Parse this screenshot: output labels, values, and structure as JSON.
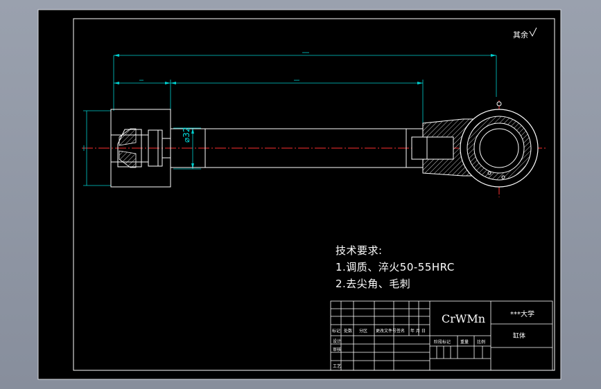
{
  "drawing": {
    "surface_roughness_note": "其余",
    "dimensions": {
      "overall_length": "",
      "left_segment": "",
      "rod_length": "",
      "block_height": "",
      "rod_diameter": "⌀32"
    },
    "technical_requirements": {
      "heading": "技术要求:",
      "items": [
        "1.调质、淬火50-55HRC",
        "2.去尖角、毛刺"
      ]
    },
    "title_block": {
      "material": "CrWMn",
      "school": "***大学",
      "part_name": "缸体",
      "row_labels_mid": [
        "标记",
        "处数",
        "分区",
        "更改文件号",
        "签名",
        "年 月 日"
      ],
      "row_labels_left": [
        "设计",
        "审核",
        "工艺"
      ],
      "stage_labels": [
        "阶段标记",
        "重量",
        "比例"
      ]
    },
    "colors": {
      "sheet_background": "#000000",
      "lines": "#ffffff",
      "dimension": "#00ffff",
      "centerline": "#ff0000"
    }
  }
}
